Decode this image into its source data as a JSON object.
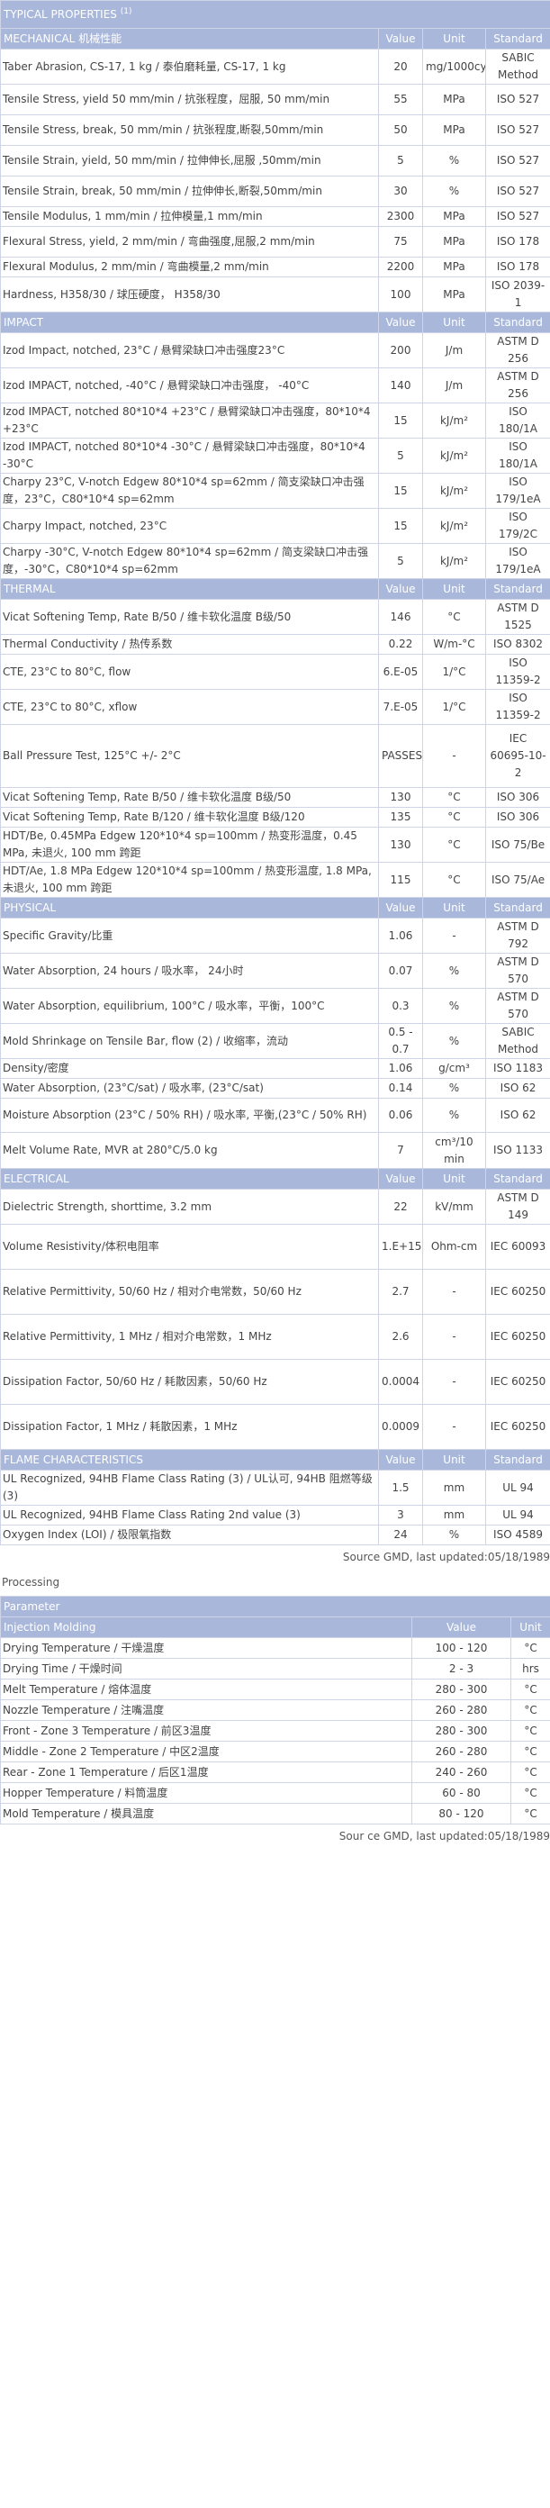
{
  "header": {
    "title": "TYPICAL PROPERTIES",
    "title_sup": "(1)"
  },
  "sections": [
    {
      "name": "MECHANICAL 机械性能",
      "col_value": "Value",
      "col_unit": "Unit",
      "col_standard": "Standard",
      "rows": [
        {
          "name": "Taber Abrasion, CS-17, 1 kg / 泰伯磨耗量, CS-17, 1 kg",
          "value": "20",
          "unit": "mg/1000cy",
          "standard": "SABIC Method"
        },
        {
          "name": "Tensile Stress, yield 50 mm/min / 抗张程度，屈服, 50 mm/min",
          "value": "55",
          "unit": "MPa",
          "standard": "ISO 527"
        },
        {
          "name": "Tensile Stress, break, 50 mm/min / 抗张程度,断裂,50mm/min",
          "value": "50",
          "unit": "MPa",
          "standard": "ISO 527"
        },
        {
          "name": "Tensile Strain, yield, 50 mm/min / 拉伸伸长,屈服 ,50mm/min",
          "value": "5",
          "unit": "%",
          "standard": "ISO 527"
        },
        {
          "name": "Tensile Strain, break, 50 mm/min / 拉伸伸长,断裂,50mm/min",
          "value": "30",
          "unit": "%",
          "standard": "ISO 527"
        },
        {
          "name": "Tensile Modulus, 1 mm/min / 拉伸模量,1 mm/min",
          "value": "2300",
          "unit": "MPa",
          "standard": "ISO 527"
        },
        {
          "name": "Flexural Stress, yield, 2 mm/min / 弯曲强度,屈服,2 mm/min",
          "value": "75",
          "unit": "MPa",
          "standard": "ISO 178"
        },
        {
          "name": "Flexural Modulus, 2 mm/min / 弯曲模量,2 mm/min",
          "value": "2200",
          "unit": "MPa",
          "standard": "ISO 178"
        },
        {
          "name": "Hardness, H358/30 / 球压硬度， H358/30",
          "value": "100",
          "unit": "MPa",
          "standard": "ISO 2039-1"
        }
      ]
    },
    {
      "name": "IMPACT",
      "col_value": "Value",
      "col_unit": "Unit",
      "col_standard": "Standard",
      "rows": [
        {
          "name": "Izod Impact, notched, 23°C / 悬臂梁缺口冲击强度23°C",
          "value": "200",
          "unit": "J/m",
          "standard": "ASTM D 256"
        },
        {
          "name": "Izod IMPACT, notched, -40°C / 悬臂梁缺口冲击强度， -40°C",
          "value": "140",
          "unit": "J/m",
          "standard": "ASTM D 256"
        },
        {
          "name": "Izod IMPACT, notched 80*10*4 +23°C / 悬臂梁缺口冲击强度，80*10*4 +23°C",
          "value": "15",
          "unit": "kJ/m²",
          "standard": "ISO 180/1A"
        },
        {
          "name": "Izod IMPACT, notched 80*10*4 -30°C / 悬臂梁缺口冲击强度，80*10*4 -30°C",
          "value": "5",
          "unit": "kJ/m²",
          "standard": "ISO 180/1A"
        },
        {
          "name": "Charpy 23°C, V-notch Edgew 80*10*4 sp=62mm / 简支梁缺口冲击强度，23°C，C80*10*4 sp=62mm",
          "value": "15",
          "unit": "kJ/m²",
          "standard": "ISO 179/1eA"
        },
        {
          "name": "Charpy Impact, notched, 23°C",
          "value": "15",
          "unit": "kJ/m²",
          "standard": "ISO 179/2C"
        },
        {
          "name": "Charpy -30°C, V-notch Edgew 80*10*4 sp=62mm / 简支梁缺口冲击强度，-30°C，C80*10*4 sp=62mm",
          "value": "5",
          "unit": "kJ/m²",
          "standard": "ISO 179/1eA"
        }
      ]
    },
    {
      "name": "THERMAL",
      "col_value": "Value",
      "col_unit": "Unit",
      "col_standard": "Standard",
      "rows": [
        {
          "name": "Vicat Softening Temp, Rate B/50 / 维卡软化温度 B级/50",
          "value": "146",
          "unit": "°C",
          "standard": "ASTM D 1525"
        },
        {
          "name": "Thermal Conductivity / 热传系数",
          "value": "0.22",
          "unit": "W/m-°C",
          "standard": "ISO 8302"
        },
        {
          "name": "CTE, 23°C to 80°C, flow",
          "value": "6.E-05",
          "unit": "1/°C",
          "standard": "ISO 11359-2"
        },
        {
          "name": "CTE, 23°C to 80°C, xflow",
          "value": "7.E-05",
          "unit": "1/°C",
          "standard": "ISO 11359-2"
        },
        {
          "name": "Ball Pressure Test, 125°C +/- 2°C",
          "value": "PASSES",
          "unit": "-",
          "standard": "IEC 60695-10-2"
        },
        {
          "name": "Vicat Softening Temp, Rate B/50 / 维卡软化温度 B级/50",
          "value": "130",
          "unit": "°C",
          "standard": "ISO 306"
        },
        {
          "name": "Vicat Softening Temp, Rate B/120 / 维卡软化温度 B级/120",
          "value": "135",
          "unit": "°C",
          "standard": "ISO 306"
        },
        {
          "name": "HDT/Be, 0.45MPa Edgew 120*10*4 sp=100mm / 热变形温度，0.45 MPa, 未退火, 100 mm 跨距",
          "value": "130",
          "unit": "°C",
          "standard": "ISO 75/Be"
        },
        {
          "name": "HDT/Ae, 1.8 MPa Edgew 120*10*4 sp=100mm / 热变形温度, 1.8 MPa, 未退火, 100 mm 跨距",
          "value": "115",
          "unit": "°C",
          "standard": "ISO 75/Ae"
        }
      ]
    },
    {
      "name": "PHYSICAL",
      "col_value": "Value",
      "col_unit": "Unit",
      "col_standard": "Standard",
      "rows": [
        {
          "name": "Specific Gravity/比重",
          "value": "1.06",
          "unit": "-",
          "standard": "ASTM D 792"
        },
        {
          "name": "Water Absorption, 24 hours / 吸水率， 24小时",
          "value": "0.07",
          "unit": "%",
          "standard": "ASTM D 570"
        },
        {
          "name": "Water Absorption, equilibrium, 100°C / 吸水率，平衡，100°C",
          "value": "0.3",
          "unit": "%",
          "standard": "ASTM D 570"
        },
        {
          "name": "Mold Shrinkage on Tensile Bar, flow (2) / 收缩率，流动",
          "value": "0.5 - 0.7",
          "unit": "%",
          "standard": "SABIC Method"
        },
        {
          "name": "Density/密度",
          "value": "1.06",
          "unit": "g/cm³",
          "standard": "ISO 1183"
        },
        {
          "name": "Water Absorption, (23°C/sat) / 吸水率, (23°C/sat)",
          "value": "0.14",
          "unit": "%",
          "standard": "ISO 62"
        },
        {
          "name": "Moisture Absorption (23°C / 50% RH) / 吸水率, 平衡,(23°C / 50% RH)",
          "value": "0.06",
          "unit": "%",
          "standard": "ISO 62"
        },
        {
          "name": "Melt Volume Rate, MVR at 280°C/5.0 kg",
          "value": "7",
          "unit": "cm³/10 min",
          "standard": "ISO 1133"
        }
      ]
    },
    {
      "name": "ELECTRICAL",
      "col_value": "Value",
      "col_unit": "Unit",
      "col_standard": "Standard",
      "rows": [
        {
          "name": "Dielectric Strength, shorttime, 3.2 mm",
          "value": "22",
          "unit": "kV/mm",
          "standard": "ASTM D 149"
        },
        {
          "name": "Volume Resistivity/体积电阻率",
          "value": "1.E+15",
          "unit": "Ohm-cm",
          "standard": "IEC 60093"
        },
        {
          "name": "Relative Permittivity, 50/60 Hz / 相对介电常数，50/60 Hz",
          "value": "2.7",
          "unit": "-",
          "standard": "IEC 60250"
        },
        {
          "name": "Relative Permittivity, 1 MHz / 相对介电常数，1 MHz",
          "value": "2.6",
          "unit": "-",
          "standard": "IEC 60250"
        },
        {
          "name": "Dissipation Factor, 50/60 Hz / 耗散因素，50/60 Hz",
          "value": "0.0004",
          "unit": "-",
          "standard": "IEC 60250"
        },
        {
          "name": "Dissipation Factor, 1 MHz / 耗散因素，1 MHz",
          "value": "0.0009",
          "unit": "-",
          "standard": "IEC 60250"
        }
      ]
    },
    {
      "name": "FLAME CHARACTERISTICS",
      "col_value": "Value",
      "col_unit": "Unit",
      "col_standard": "Standard",
      "rows": [
        {
          "name": "UL Recognized, 94HB Flame Class Rating (3) / UL认可, 94HB 阻燃等级(3)",
          "value": "1.5",
          "unit": "mm",
          "standard": "UL 94"
        },
        {
          "name": "UL Recognized, 94HB Flame Class Rating 2nd value (3)",
          "value": "3",
          "unit": "mm",
          "standard": "UL 94"
        },
        {
          "name": "Oxygen Index (LOI) / 极限氧指数",
          "value": "24",
          "unit": "%",
          "standard": "ISO 4589"
        }
      ]
    }
  ],
  "source_note": "Source GMD, last updated:05/18/1989",
  "processing": {
    "label": "Processing",
    "param_header": "Parameter",
    "group_name": "Injection Molding",
    "col_value": "Value",
    "col_unit": "Unit",
    "rows": [
      {
        "name": "Drying Temperature / 干燥温度",
        "value": "100 - 120",
        "unit": "°C"
      },
      {
        "name": "Drying Time / 干燥时间",
        "value": "2 - 3",
        "unit": "hrs"
      },
      {
        "name": "Melt Temperature / 熔体温度",
        "value": "280 - 300",
        "unit": "°C"
      },
      {
        "name": "Nozzle Temperature / 注嘴温度",
        "value": "260 - 280",
        "unit": "°C"
      },
      {
        "name": "Front - Zone 3 Temperature / 前区3温度",
        "value": "280 - 300",
        "unit": "°C"
      },
      {
        "name": "Middle - Zone 2 Temperature / 中区2温度",
        "value": "260 - 280",
        "unit": "°C"
      },
      {
        "name": "Rear - Zone 1 Temperature / 后区1温度",
        "value": "240 - 260",
        "unit": "°C"
      },
      {
        "name": "Hopper Temperature / 料筒温度",
        "value": "60 - 80",
        "unit": "°C"
      },
      {
        "name": "Mold Temperature / 模具温度",
        "value": "80 - 120",
        "unit": "°C"
      }
    ],
    "source_note": "Sour ce GMD, last updated:05/18/1989"
  }
}
